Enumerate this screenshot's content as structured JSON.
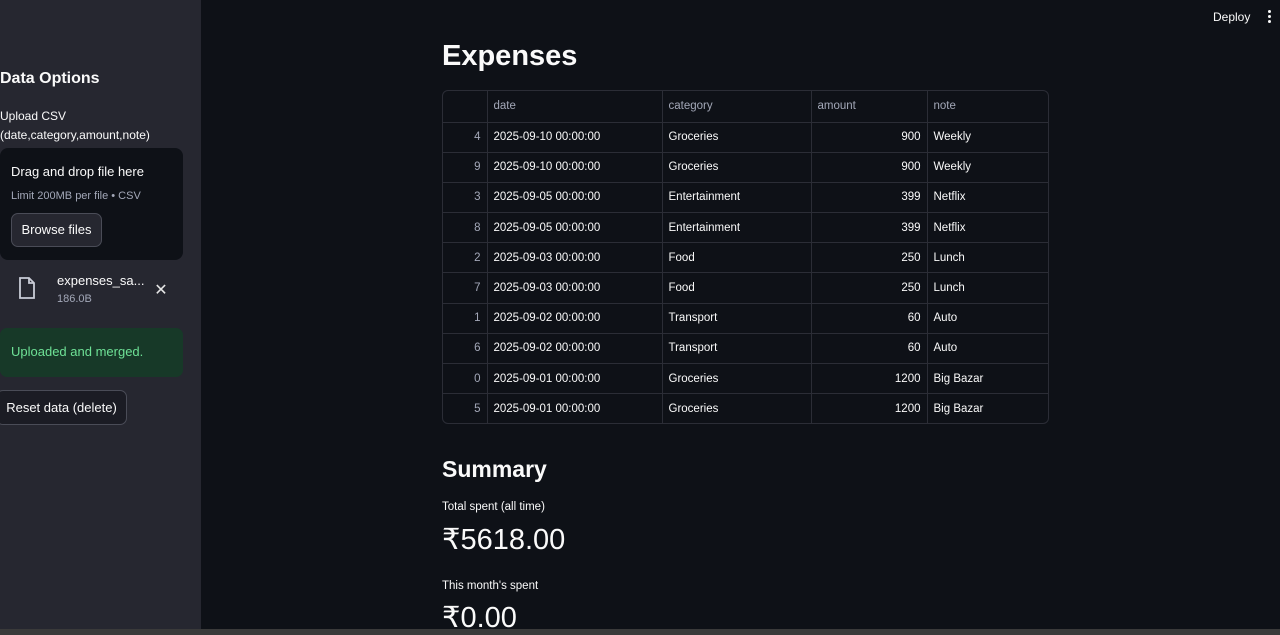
{
  "sidebar": {
    "title": "Data Options",
    "upload_label": "Upload CSV (date,category,amount,note)",
    "dropzone_title": "Drag and drop file here",
    "dropzone_limit": "Limit 200MB per file • CSV",
    "browse_label": "Browse files",
    "file": {
      "name": "expenses_sa...",
      "size": "186.0B"
    },
    "success_message": "Uploaded and merged.",
    "reset_label": "Reset data (delete)"
  },
  "header": {
    "deploy_label": "Deploy"
  },
  "main": {
    "title": "Expenses",
    "table": {
      "columns": [
        "",
        "date",
        "category",
        "amount",
        "note"
      ],
      "rows": [
        [
          "4",
          "2025-09-10 00:00:00",
          "Groceries",
          "900",
          "Weekly"
        ],
        [
          "9",
          "2025-09-10 00:00:00",
          "Groceries",
          "900",
          "Weekly"
        ],
        [
          "3",
          "2025-09-05 00:00:00",
          "Entertainment",
          "399",
          "Netflix"
        ],
        [
          "8",
          "2025-09-05 00:00:00",
          "Entertainment",
          "399",
          "Netflix"
        ],
        [
          "2",
          "2025-09-03 00:00:00",
          "Food",
          "250",
          "Lunch"
        ],
        [
          "7",
          "2025-09-03 00:00:00",
          "Food",
          "250",
          "Lunch"
        ],
        [
          "1",
          "2025-09-02 00:00:00",
          "Transport",
          "60",
          "Auto"
        ],
        [
          "6",
          "2025-09-02 00:00:00",
          "Transport",
          "60",
          "Auto"
        ],
        [
          "0",
          "2025-09-01 00:00:00",
          "Groceries",
          "1200",
          "Big Bazar"
        ],
        [
          "5",
          "2025-09-01 00:00:00",
          "Groceries",
          "1200",
          "Big Bazar"
        ]
      ]
    },
    "summary": {
      "title": "Summary",
      "total_label": "Total spent (all time)",
      "total_value": "₹5618.00",
      "month_label": "This month's spent",
      "month_value": "₹0.00"
    }
  },
  "colors": {
    "background": "#0e1117",
    "sidebar": "#262730",
    "success_bg": "#173928",
    "success_text": "#6ee196"
  },
  "icons": {
    "file": "file-icon",
    "close": "close-icon",
    "menu": "kebab-menu-icon"
  }
}
